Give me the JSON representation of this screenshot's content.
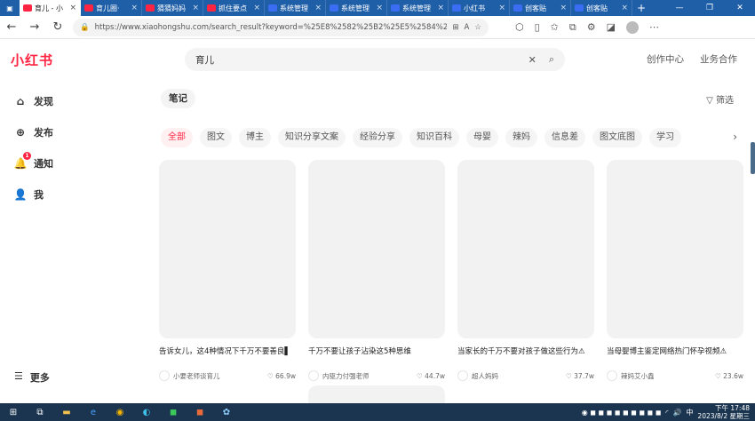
{
  "browser": {
    "tabs": [
      {
        "label": "育儿 - 小",
        "active": true,
        "color": "#ff2442"
      },
      {
        "label": "育儿圈·",
        "active": false,
        "color": "#ff2442"
      },
      {
        "label": "猜猜妈妈",
        "active": false,
        "color": "#ff2442"
      },
      {
        "label": "抓住要点",
        "active": false,
        "color": "#ff2442"
      },
      {
        "label": "系统管理",
        "active": false,
        "color": "#3b6df2"
      },
      {
        "label": "系统管理",
        "active": false,
        "color": "#3b6df2"
      },
      {
        "label": "系统管理",
        "active": false,
        "color": "#3b6df2"
      },
      {
        "label": "小红书",
        "active": false,
        "color": "#3b6df2"
      },
      {
        "label": "创客贴",
        "active": false,
        "color": "#3b6df2"
      },
      {
        "label": "创客贴",
        "active": false,
        "color": "#3b6df2"
      }
    ],
    "url": "https://www.xiaohongshu.com/search_result?keyword=%25E8%2582%25B2%25E5%2584%25BF&source=w..."
  },
  "header": {
    "logo": "小红书",
    "search_query": "育儿",
    "links": [
      "创作中心",
      "业务合作"
    ]
  },
  "sidebar": {
    "items": [
      {
        "label": "发现",
        "icon": "home-icon"
      },
      {
        "label": "发布",
        "icon": "plus-circle-icon"
      },
      {
        "label": "通知",
        "icon": "bell-icon",
        "badge": "1"
      },
      {
        "label": "我",
        "icon": "avatar-icon"
      }
    ],
    "more": "更多"
  },
  "main": {
    "note_tab": "笔记",
    "filter": "筛选",
    "chips": [
      "全部",
      "图文",
      "博主",
      "知识分享文案",
      "经验分享",
      "知识百科",
      "母婴",
      "辣妈",
      "信息差",
      "图文底图",
      "学习"
    ],
    "cards": [
      {
        "title": "告诉女儿，这4种情况下千万不要善良▌",
        "author": "小要老师谈育儿",
        "likes": "66.9w"
      },
      {
        "title": "千万不要让孩子沾染这5种思维",
        "author": "内驱力付强老师",
        "likes": "44.7w"
      },
      {
        "title": "当家长的千万不要对孩子做这些行为⚠",
        "author": "超人妈妈",
        "likes": "37.7w"
      },
      {
        "title": "当母婴博主鉴定网络热门怀孕视频⚠",
        "author": "辣妈艾小鑫",
        "likes": "23.6w"
      }
    ]
  },
  "taskbar": {
    "time": "下午 17:48",
    "date": "2023/8/2 星期三",
    "ime": "中"
  }
}
